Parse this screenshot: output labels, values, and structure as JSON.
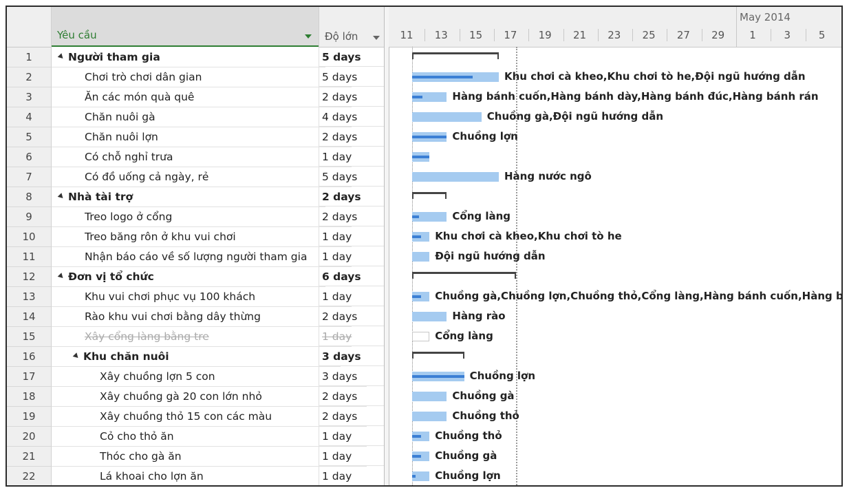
{
  "headers": {
    "name": "Yêu cầu",
    "duration": "Độ lớn",
    "month": "May 2014",
    "days": [
      "11",
      "13",
      "15",
      "17",
      "19",
      "21",
      "23",
      "25",
      "27",
      "29",
      "1",
      "3",
      "5"
    ]
  },
  "colors": {
    "bar": "#a5cbf0",
    "progress": "#3b7fd4",
    "header_accent": "#2e7d32"
  },
  "tasks": [
    {
      "id": "1",
      "name": "Người tham gia",
      "duration": "5 days",
      "level": 0,
      "summary": true,
      "resources": ""
    },
    {
      "id": "2",
      "name": "Chơi trò chơi dân gian",
      "duration": "5 days",
      "level": 1,
      "summary": false,
      "resources": "Khu chơi cà kheo,Khu chơi tò he,Đội ngũ hướng dẫn"
    },
    {
      "id": "3",
      "name": "Ăn các món quà quê",
      "duration": "2 days",
      "level": 1,
      "summary": false,
      "resources": "Hàng bánh cuốn,Hàng bánh dày,Hàng bánh đúc,Hàng bánh rán"
    },
    {
      "id": "4",
      "name": "Chăn nuôi gà",
      "duration": "4 days",
      "level": 1,
      "summary": false,
      "resources": "Chuồng gà,Đội ngũ hướng dẫn"
    },
    {
      "id": "5",
      "name": "Chăn nuôi lợn",
      "duration": "2 days",
      "level": 1,
      "summary": false,
      "resources": "Chuồng lợn"
    },
    {
      "id": "6",
      "name": "Có chỗ nghỉ trưa",
      "duration": "1 day",
      "level": 1,
      "summary": false,
      "resources": ""
    },
    {
      "id": "7",
      "name": "Có đồ uống cả ngày, rẻ",
      "duration": "5 days",
      "level": 1,
      "summary": false,
      "resources": "Hàng nước ngô"
    },
    {
      "id": "8",
      "name": "Nhà tài trợ",
      "duration": "2 days",
      "level": 0,
      "summary": true,
      "resources": ""
    },
    {
      "id": "9",
      "name": "Treo logo ở cổng",
      "duration": "2 days",
      "level": 1,
      "summary": false,
      "resources": "Cổng làng"
    },
    {
      "id": "10",
      "name": "Treo băng rôn ở khu vui chơi",
      "duration": "1 day",
      "level": 1,
      "summary": false,
      "resources": "Khu chơi cà kheo,Khu chơi tò he"
    },
    {
      "id": "11",
      "name": "Nhận báo cáo về số lượng người tham gia",
      "duration": "1 day",
      "level": 1,
      "summary": false,
      "resources": "Đội ngũ hướng dẫn"
    },
    {
      "id": "12",
      "name": "Đơn vị tổ chức",
      "duration": "6 days",
      "level": 0,
      "summary": true,
      "resources": ""
    },
    {
      "id": "13",
      "name": "Khu vui chơi phục vụ 100 khách",
      "duration": "1 day",
      "level": 1,
      "summary": false,
      "resources": "Chuồng gà,Chuồng lợn,Chuồng thỏ,Cổng làng,Hàng bánh cuốn,Hàng bánh dày,"
    },
    {
      "id": "14",
      "name": "Rào khu vui chơi bằng dây thừng",
      "duration": "2 days",
      "level": 1,
      "summary": false,
      "resources": "Hàng rào"
    },
    {
      "id": "15",
      "name": "Xây cổng làng bằng tre",
      "duration": "1 day",
      "level": 1,
      "summary": false,
      "inactive": true,
      "resources": "Cổng làng"
    },
    {
      "id": "16",
      "name": "Khu chăn nuôi",
      "duration": "3 days",
      "level": 1,
      "summary": true,
      "resources": ""
    },
    {
      "id": "17",
      "name": "Xây chuồng lợn 5 con",
      "duration": "3 days",
      "level": 2,
      "summary": false,
      "resources": "Chuồng lợn"
    },
    {
      "id": "18",
      "name": "Xây chuồng gà 20 con lớn nhỏ",
      "duration": "2 days",
      "level": 2,
      "summary": false,
      "resources": "Chuồng gà"
    },
    {
      "id": "19",
      "name": "Xây chuồng thỏ 15 con các màu",
      "duration": "2 days",
      "level": 2,
      "summary": false,
      "resources": "Chuồng thỏ"
    },
    {
      "id": "20",
      "name": "Cỏ cho thỏ ăn",
      "duration": "1 day",
      "level": 2,
      "summary": false,
      "resources": "Chuồng thỏ"
    },
    {
      "id": "21",
      "name": "Thóc cho gà ăn",
      "duration": "1 day",
      "level": 2,
      "summary": false,
      "resources": "Chuồng gà"
    },
    {
      "id": "22",
      "name": "Lá khoai cho lợn ăn",
      "duration": "1 day",
      "level": 2,
      "summary": false,
      "resources": "Chuồng lợn"
    }
  ],
  "progress": [
    null,
    0.7,
    0.3,
    0,
    1,
    1,
    0,
    null,
    0.2,
    0.5,
    0,
    null,
    0.5,
    0,
    0,
    null,
    1,
    0,
    0,
    0.5,
    0.5,
    0.2
  ]
}
